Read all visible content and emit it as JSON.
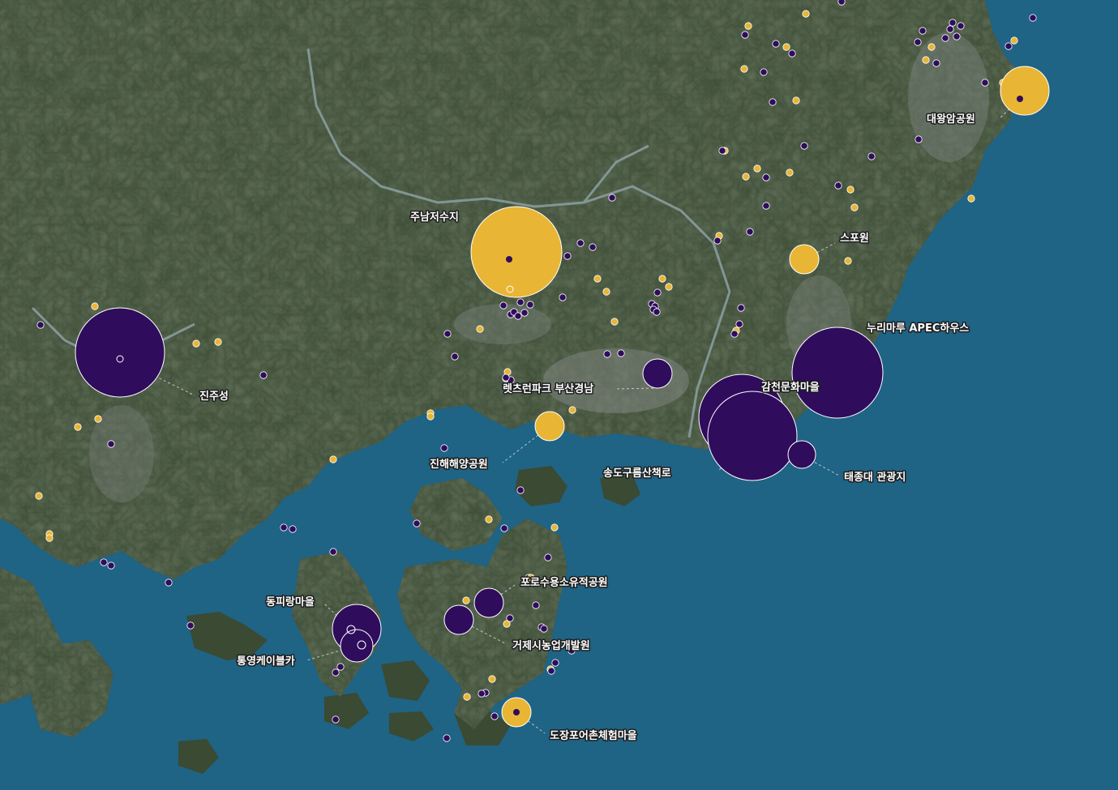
{
  "colors": {
    "sea": "#1f6385",
    "sea_deep": "#1b5a7c",
    "land": "#3a4a33",
    "land_dark": "#27331f",
    "land_light": "#5d6a4d",
    "urban": "#7d8580",
    "river": "#8fa5a9",
    "purple": "#2f0c5c",
    "yellow": "#e8b535",
    "marker_outline": "#ffffff"
  },
  "icons": {
    "purple_marker": "purple-circle-marker-icon",
    "yellow_marker": "yellow-circle-marker-icon"
  },
  "labels": [
    {
      "id": "label-daewangam",
      "text": "대왕암공원"
    },
    {
      "id": "label-junamjeosuji",
      "text": "주남저수지"
    },
    {
      "id": "label-spowon",
      "text": "스포원"
    },
    {
      "id": "label-nurimaru",
      "text": "누리마루 APEC하우스"
    },
    {
      "id": "label-jinjuseong",
      "text": "진주성"
    },
    {
      "id": "label-gamcheon",
      "text": "감천문화마을"
    },
    {
      "id": "label-lettrun",
      "text": "렛츠런파크 부산경남"
    },
    {
      "id": "label-jinhae",
      "text": "진해해양공원"
    },
    {
      "id": "label-songdo",
      "text": "송도구름산책로"
    },
    {
      "id": "label-taejongdae",
      "text": "태종대 관광지"
    },
    {
      "id": "label-pororo",
      "text": "포로수용소유적공원"
    },
    {
      "id": "label-dongpirang",
      "text": "동피랑마을"
    },
    {
      "id": "label-geoje-agri",
      "text": "거제시농업개발원"
    },
    {
      "id": "label-tongyeong-cable",
      "text": "통영케이블카"
    },
    {
      "id": "label-dojangpo",
      "text": "도장포어촌체험마을"
    }
  ],
  "legend_values": {
    "large_marker_categories": [
      "purple",
      "yellow"
    ]
  }
}
